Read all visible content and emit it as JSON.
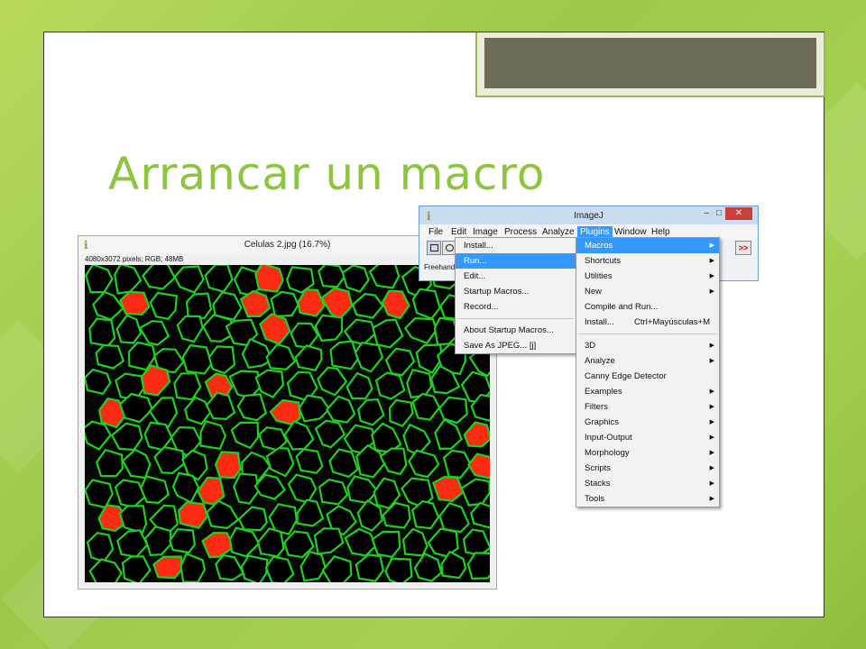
{
  "slide": {
    "title": "Arrancar un macro"
  },
  "image_window": {
    "title": "Celulas 2.jpg (16.7%)",
    "info": "4080x3072 pixels; RGB; 48MB"
  },
  "imagej_window": {
    "title": "ImageJ",
    "menus": [
      "File",
      "Edit",
      "Image",
      "Process",
      "Analyze",
      "Plugins",
      "Window",
      "Help"
    ],
    "active_menu": "Plugins",
    "status_text": "Freehand",
    "overflow_label": ">>",
    "close_label": "✕",
    "minimize_label": "–",
    "maximize_label": "□"
  },
  "macros_menu": {
    "items": [
      {
        "label": "Install..."
      },
      {
        "label": "Run..."
      },
      {
        "label": "Edit..."
      },
      {
        "label": "Startup Macros..."
      },
      {
        "label": "Record..."
      },
      {
        "label": "About Startup Macros..."
      },
      {
        "label": "Save As JPEG... [j]"
      }
    ],
    "selected": "Run..."
  },
  "plugins_menu": {
    "items": [
      {
        "label": "Macros",
        "submenu": true
      },
      {
        "label": "Shortcuts",
        "submenu": true
      },
      {
        "label": "Utilities",
        "submenu": true
      },
      {
        "label": "New",
        "submenu": true
      },
      {
        "label": "Compile and Run..."
      },
      {
        "label": "Install...",
        "shortcut": "Ctrl+Mayúsculas+M"
      },
      {
        "label": "3D",
        "submenu": true
      },
      {
        "label": "Analyze",
        "submenu": true
      },
      {
        "label": "Canny Edge Detector"
      },
      {
        "label": "Examples",
        "submenu": true
      },
      {
        "label": "Filters",
        "submenu": true
      },
      {
        "label": "Graphics",
        "submenu": true
      },
      {
        "label": "Input-Output",
        "submenu": true
      },
      {
        "label": "Morphology",
        "submenu": true
      },
      {
        "label": "Scripts",
        "submenu": true
      },
      {
        "label": "Stacks",
        "submenu": true
      },
      {
        "label": "Tools",
        "submenu": true
      }
    ],
    "selected": "Macros"
  },
  "colors": {
    "accent_green": "#8cc63f",
    "menu_highlight": "#3399ff",
    "cell_border": "#1fd01f",
    "cell_marker": "#ff2a14"
  }
}
